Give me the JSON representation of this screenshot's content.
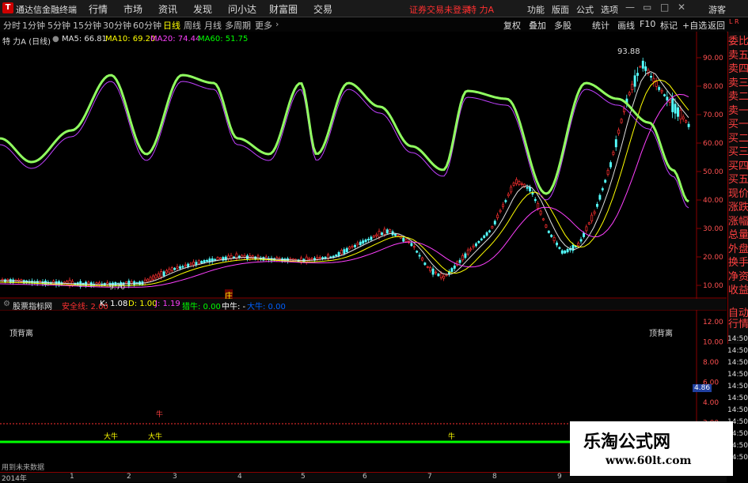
{
  "menubar": {
    "app_title": "通达信金融终端",
    "items": [
      "行情",
      "市场",
      "资讯",
      "发现",
      "问小达",
      "财富圈",
      "交易"
    ],
    "login_warning": "证券交易未登录",
    "stock_name": "特 力A",
    "right_items": [
      "功能",
      "版面",
      "公式",
      "选项"
    ],
    "guest": "游客"
  },
  "periods": [
    "分时",
    "1分钟",
    "5分钟",
    "15分钟",
    "30分钟",
    "60分钟",
    "日线",
    "周线",
    "月线",
    "多周期",
    "更多"
  ],
  "active_period": "日线",
  "toolbar": [
    "复权",
    "叠加",
    "多股",
    "统计",
    "画线",
    "F10",
    "标记",
    "+自选",
    "返回"
  ],
  "main": {
    "title": "特 力A (日线)",
    "ma5": "MA5: 66.81",
    "ma10": "MA10: 69.20",
    "ma20": "MA20: 74.44",
    "ma60": "MA60: 51.75",
    "high_label": "93.88",
    "low_label": "9.70",
    "marker": "庄",
    "y_ticks": [
      "90.00",
      "80.00",
      "70.00",
      "60.00",
      "50.00",
      "40.00",
      "30.00",
      "20.00",
      "10.00"
    ]
  },
  "right_panel": [
    "委比",
    "卖五",
    "卖四",
    "卖三",
    "卖二",
    "卖一",
    "买一",
    "买二",
    "买三",
    "买四",
    "买五",
    "现价",
    "涨跌",
    "涨幅",
    "总量",
    "外盘",
    "换手",
    "净资",
    "收益"
  ],
  "indicator": {
    "name": "股票指标网",
    "items": [
      {
        "text": "安全线: 2.00",
        "color": "#ff3030"
      },
      {
        "text": "K: 1.08",
        "color": "#ffffff"
      },
      {
        "text": "D: 1.00",
        "color": "#ffff00"
      },
      {
        "text": "J: 1.19",
        "color": "#ff40ff"
      },
      {
        "text": "猎牛: 0.00",
        "color": "#00ff00"
      },
      {
        "text": "中牛: -",
        "color": "#ffffff"
      },
      {
        "text": "大牛: 0.00",
        "color": "#0060ff"
      }
    ],
    "top_divergence": "顶背离",
    "bull_labels": [
      "大牛",
      "大牛",
      "牛",
      "牛"
    ],
    "y_ticks": [
      "12.00",
      "10.00",
      "8.00",
      "6.00",
      "4.00",
      "2.00"
    ],
    "current_value": "4.86",
    "future_note": "用到未来数据"
  },
  "right_bottom": {
    "labels": [
      "自动",
      "行情"
    ],
    "times": [
      "14:50",
      "14:50",
      "14:50",
      "14:50",
      "14:50",
      "14:50",
      "14:50",
      "14:50",
      "14:50",
      "14:50",
      "14:50"
    ]
  },
  "dates": [
    "2014年",
    "1",
    "2",
    "3",
    "4",
    "5",
    "6",
    "7",
    "8",
    "9"
  ],
  "watermark": {
    "cn": "乐淘公式网",
    "url": "www.60lt.com"
  }
}
